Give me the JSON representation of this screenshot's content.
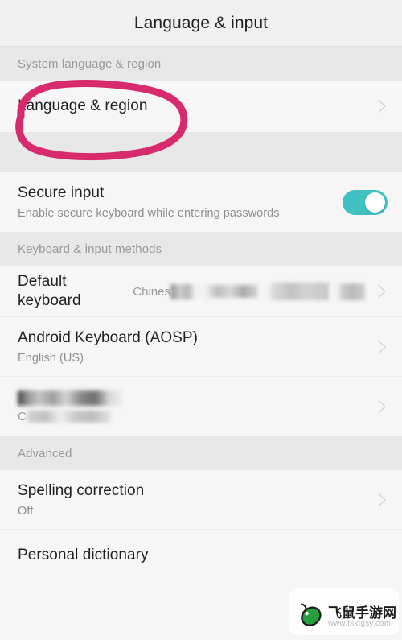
{
  "appbar": {
    "title": "Language & input"
  },
  "sections": [
    {
      "id": "system-language-region",
      "header": "System language & region"
    },
    {
      "id": "keyboard-input-methods",
      "header": "Keyboard & input methods"
    },
    {
      "id": "advanced",
      "header": "Advanced"
    }
  ],
  "rows": {
    "language_region": {
      "title": "Language & region",
      "chevron": "chevron-right-icon"
    },
    "secure_input": {
      "title": "Secure input",
      "subtitle": "Enable secure keyboard while entering passwords",
      "toggle_state": "on",
      "toggle_color": "#41c2c2"
    },
    "default_keyboard": {
      "title": "Default keyboard",
      "value_visible": "Chines",
      "value_redacted": true,
      "chevron": "chevron-right-icon"
    },
    "android_keyboard": {
      "title": "Android Keyboard (AOSP)",
      "subtitle": "English (US)",
      "chevron": "chevron-right-icon"
    },
    "redacted_keyboard": {
      "title": "",
      "title_redacted": true,
      "subtitle_visible": "C",
      "subtitle_redacted": true,
      "chevron": "chevron-right-icon"
    },
    "spelling_correction": {
      "title": "Spelling correction",
      "subtitle": "Off",
      "chevron": "chevron-right-icon"
    },
    "personal_dictionary": {
      "title": "Personal dictionary",
      "chevron": "chevron-right-icon"
    }
  },
  "annotation": {
    "shape": "hand-drawn-ellipse",
    "color": "#d82b6e",
    "target": "Language & region"
  },
  "watermark": {
    "name": "飞鼠手游网",
    "url": "www.fsktgsy.com",
    "logo_color": "#21a03c"
  },
  "colors": {
    "page_bg": "#f6f6f6",
    "appbar_bg": "#f0f0f0",
    "band_bg": "#e8e8e8",
    "divider": "#ececec",
    "title_text": "#1f1f1f",
    "secondary_text": "#8e8e8e",
    "band_text": "#9a9a9a",
    "accent_toggle": "#41c2c2",
    "annotation_pink": "#d82b6e"
  }
}
